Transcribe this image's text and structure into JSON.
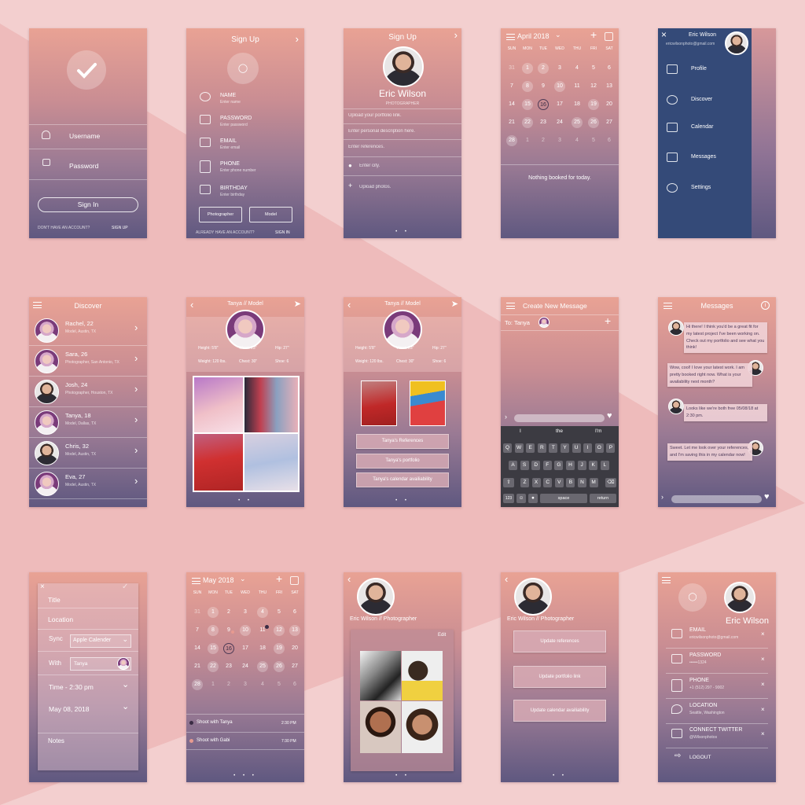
{
  "s1": {
    "username": "Username",
    "password": "Password",
    "signin": "Sign In",
    "no_account": "DON'T HAVE AN ACCOUNT?",
    "signup": "SIGN UP"
  },
  "s2": {
    "title": "Sign Up",
    "fields": [
      {
        "label": "NAME",
        "hint": "Enter name"
      },
      {
        "label": "PASSWORD",
        "hint": "Enter password"
      },
      {
        "label": "EMAIL",
        "hint": "Enter email"
      },
      {
        "label": "PHONE",
        "hint": "Enter phone number"
      },
      {
        "label": "BIRTHDAY",
        "hint": "Enter birthday"
      }
    ],
    "photographer": "Photographer",
    "model": "Model",
    "have_account": "ALREADY HAVE AN ACCOUNT?",
    "signin": "SIGN IN"
  },
  "s3": {
    "title": "Sign Up",
    "name": "Eric Wilson",
    "role": "PHOTOGRAPHER",
    "portfolio": "Upload your portfolio link.",
    "description": "Enter personal description here.",
    "references": "Enter references.",
    "city": "Enter city.",
    "photos": "Upload photos."
  },
  "s4": {
    "month": "April 2018",
    "weekdays": [
      "SUN",
      "MON",
      "TUE",
      "WED",
      "THU",
      "FRI",
      "SAT"
    ],
    "days": [
      "31",
      "1",
      "2",
      "3",
      "4",
      "5",
      "6",
      "7",
      "8",
      "9",
      "10",
      "11",
      "12",
      "13",
      "14",
      "15",
      "16",
      "17",
      "18",
      "19",
      "20",
      "21",
      "22",
      "23",
      "24",
      "25",
      "26",
      "27",
      "28",
      "1",
      "2",
      "3",
      "4",
      "5",
      "6"
    ],
    "empty": "Nothing booked for today."
  },
  "s5": {
    "name": "Eric Wilson",
    "email": "ericwilsonphoto@gmail.com",
    "items": [
      "Profile",
      "Discover",
      "Calendar",
      "Messages",
      "Settings"
    ]
  },
  "s6": {
    "title": "Discover",
    "people": [
      {
        "name": "Rachel, 22",
        "detail": "Model, Austin, TX"
      },
      {
        "name": "Sara, 26",
        "detail": "Photographer, San Antonio, TX"
      },
      {
        "name": "Josh, 24",
        "detail": "Photographer, Houston, TX"
      },
      {
        "name": "Tanya, 18",
        "detail": "Model, Dallas, TX"
      },
      {
        "name": "Chris, 32",
        "detail": "Model, Austin, TX"
      },
      {
        "name": "Eva, 27",
        "detail": "Model, Austin, TX"
      }
    ]
  },
  "s7": {
    "title": "Tanya // Model",
    "stats": [
      "Height: 5'8\"",
      "Waist: 23\"",
      "Hip: 27\"",
      "Weight: 120 lbs.",
      "Chest: 30\"",
      "Shoe: 6"
    ]
  },
  "s8": {
    "title": "Tanya // Model",
    "stats": [
      "Height: 5'8\"",
      "Waist: 23\"",
      "Hip: 27\"",
      "Weight: 120 lbs.",
      "Chest: 30\"",
      "Shoe: 6"
    ],
    "references": "Tanya's References",
    "portfolio": "Tanya's portfolio",
    "calendar": "Tanya's calendar availiability"
  },
  "s9": {
    "title": "Create New Message",
    "to": "To: Tanya",
    "suggest": [
      "I",
      "the",
      "I'm"
    ],
    "rows": [
      [
        "Q",
        "W",
        "E",
        "R",
        "T",
        "Y",
        "U",
        "I",
        "O",
        "P"
      ],
      [
        "A",
        "S",
        "D",
        "F",
        "G",
        "H",
        "J",
        "K",
        "L"
      ],
      [
        "Z",
        "X",
        "C",
        "V",
        "B",
        "N",
        "M"
      ]
    ],
    "k123": "123",
    "space": "space",
    "ret": "return"
  },
  "s10": {
    "title": "Messages",
    "msgs": [
      "Hi there! I think you'd be a great fit for my latest project I've been working on. Check out my portfolio and see what you think!",
      "Wow, cool! I love your latest work.  I am pretty booked right now. What is your availability next month?",
      "Looks like we're both free 05/08/18 at 2:30 pm.",
      "Sweet. Let me look over your references, and I'm saving this in my calendar now!"
    ]
  },
  "s11": {
    "title": "Title",
    "location": "Location",
    "sync": "Sync",
    "sync_val": "Apple Calender",
    "with": "With",
    "with_val": "Tanya",
    "time": "Time - 2:30 pm",
    "date": "May 08, 2018",
    "notes": "Notes"
  },
  "s12": {
    "month": "May 2018",
    "weekdays": [
      "SUN",
      "MON",
      "TUE",
      "WED",
      "THU",
      "FRI",
      "SAT"
    ],
    "days": [
      "31",
      "1",
      "2",
      "3",
      "4",
      "5",
      "6",
      "7",
      "8",
      "9",
      "10",
      "11",
      "12",
      "13",
      "14",
      "15",
      "16",
      "17",
      "18",
      "19",
      "20",
      "21",
      "22",
      "23",
      "24",
      "25",
      "26",
      "27",
      "28",
      "1",
      "2",
      "3",
      "4",
      "5",
      "6"
    ],
    "events": [
      {
        "title": "Shoot with Tanya",
        "time": "2:30 PM"
      },
      {
        "title": "Shoot with Gabi",
        "time": "7:30 PM"
      }
    ]
  },
  "s13": {
    "name": "Eric Wilson // Photographer",
    "edit": "Edit"
  },
  "s14": {
    "name": "Eric Wilson // Photographer",
    "refs": "Update  references",
    "link": "Update portfolio link",
    "cal": "Update calendar availiability"
  },
  "s15": {
    "name": "Eric Wilson",
    "rows": [
      {
        "label": "EMAIL",
        "value": "ericwilsonphoto@gmail.com"
      },
      {
        "label": "PASSWORD",
        "value": "••••••1324"
      },
      {
        "label": "PHONE",
        "value": "+1 (512) 297 - 9002"
      },
      {
        "label": "LOCATION",
        "value": "Seattle, Washington"
      },
      {
        "label": "CONNECT TWITTER",
        "value": "@Wilsonphotos"
      }
    ],
    "logout": "LOGOUT"
  }
}
